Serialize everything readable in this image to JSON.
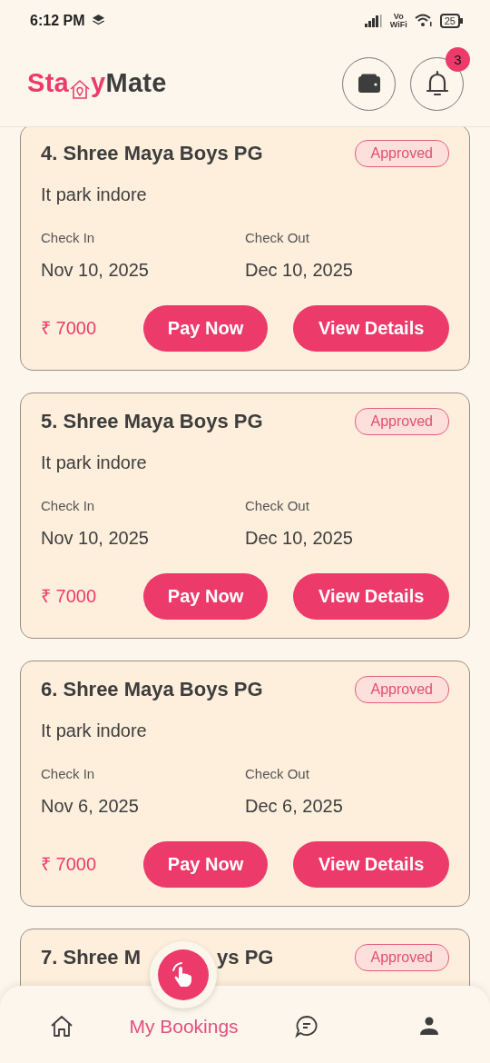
{
  "status_bar": {
    "time": "6:12 PM",
    "volte_top": "Vo",
    "volte_bottom": "WiFi",
    "battery": "25"
  },
  "header": {
    "logo_accent": "Sta",
    "logo_accent_tail": "y",
    "logo_rest": "Mate",
    "notification_count": "3"
  },
  "bookings": [
    {
      "title": "4. Shree Maya Boys PG",
      "status": "Approved",
      "location": "It park indore",
      "check_in_label": "Check In",
      "check_in": "Nov 10, 2025",
      "check_out_label": "Check Out",
      "check_out": "Dec 10, 2025",
      "price": "₹ 7000",
      "pay_label": "Pay Now",
      "details_label": "View Details"
    },
    {
      "title": "5. Shree Maya Boys PG",
      "status": "Approved",
      "location": "It park indore",
      "check_in_label": "Check In",
      "check_in": "Nov 10, 2025",
      "check_out_label": "Check Out",
      "check_out": "Dec 10, 2025",
      "price": "₹ 7000",
      "pay_label": "Pay Now",
      "details_label": "View Details"
    },
    {
      "title": "6. Shree Maya Boys PG",
      "status": "Approved",
      "location": "It park indore",
      "check_in_label": "Check In",
      "check_in": "Nov 6, 2025",
      "check_out_label": "Check Out",
      "check_out": "Dec 6, 2025",
      "price": "₹ 7000",
      "pay_label": "Pay Now",
      "details_label": "View Details"
    },
    {
      "title_parts": [
        "7. Shree M",
        "ys PG"
      ],
      "status": "Approved"
    }
  ],
  "bottom_nav": [
    {
      "kind": "home",
      "selected": false
    },
    {
      "kind": "bookings",
      "label": "My Bookings",
      "selected": true
    },
    {
      "kind": "chat",
      "selected": false
    },
    {
      "kind": "profile",
      "selected": false
    }
  ]
}
